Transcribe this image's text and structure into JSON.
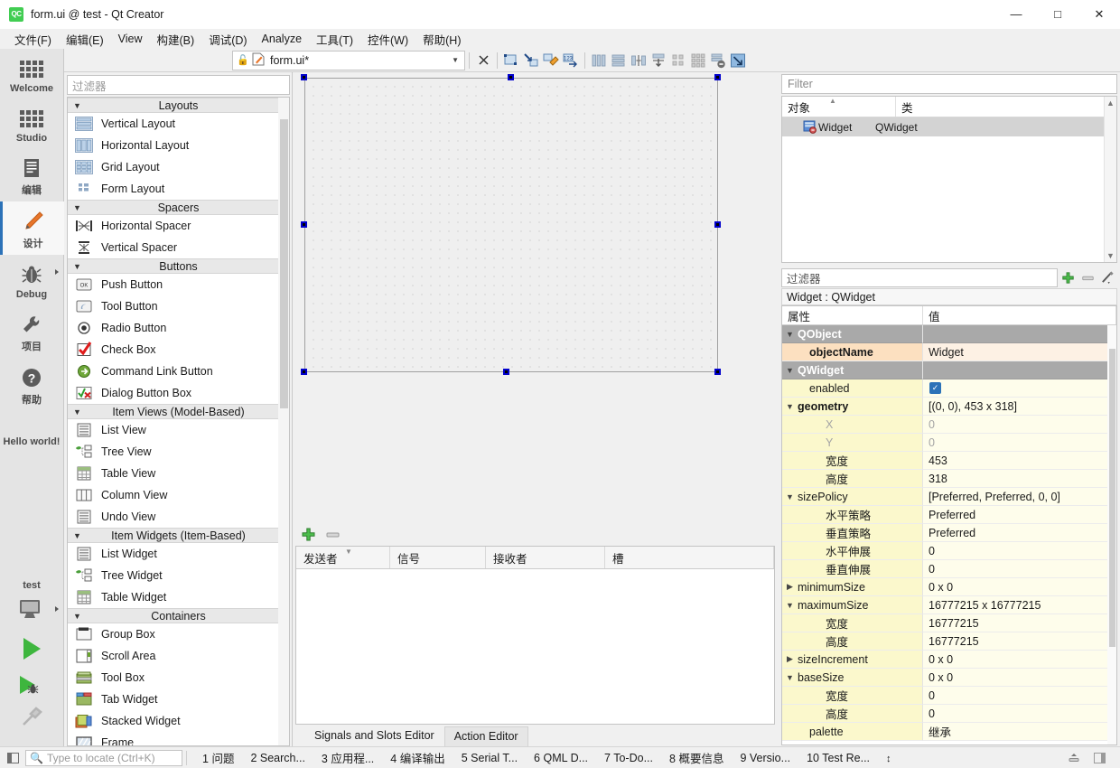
{
  "window": {
    "title": "form.ui @ test - Qt Creator",
    "app_icon_text": "QC",
    "minimize": "—",
    "maximize": "□",
    "close": "✕"
  },
  "menubar": {
    "items": [
      {
        "label": "文件(F)",
        "mnemonic": "F"
      },
      {
        "label": "编辑(E)",
        "mnemonic": "E"
      },
      {
        "label": "View",
        "mnemonic": "V"
      },
      {
        "label": "构建(B)",
        "mnemonic": "B"
      },
      {
        "label": "调试(D)",
        "mnemonic": "D"
      },
      {
        "label": "Analyze",
        "mnemonic": "A"
      },
      {
        "label": "工具(T)",
        "mnemonic": "T"
      },
      {
        "label": "控件(W)",
        "mnemonic": "W"
      },
      {
        "label": "帮助(H)",
        "mnemonic": "H"
      }
    ]
  },
  "modebar": {
    "items": [
      {
        "label": "Welcome",
        "icon": "grid-dots-icon",
        "active": false,
        "arrow": false
      },
      {
        "label": "Studio",
        "icon": "grid-dots-icon",
        "active": false,
        "arrow": false
      },
      {
        "label": "编辑",
        "icon": "document-lines-icon",
        "active": false,
        "arrow": false
      },
      {
        "label": "设计",
        "icon": "pencil-icon",
        "active": true,
        "arrow": false
      },
      {
        "label": "Debug",
        "icon": "bug-icon",
        "active": false,
        "arrow": true
      },
      {
        "label": "项目",
        "icon": "wrench-icon",
        "active": false,
        "arrow": false
      },
      {
        "label": "帮助",
        "icon": "question-circle-icon",
        "active": false,
        "arrow": false
      }
    ],
    "hello_world": "Hello world!",
    "kit_name": "test",
    "kit_icon": "desktop-monitor-icon",
    "run_icon": "run-play-icon",
    "debug_icon": "debug-play-icon",
    "build_icon": "hammer-icon"
  },
  "editor_toolbar": {
    "file_name": "form.ui*",
    "lock_icon": "unlocked-icon",
    "file_icon": "ui-file-icon",
    "dropdown_icon": "chevron-down-icon",
    "close_icon": "close-x-icon",
    "buttons": [
      {
        "name": "edit-widgets-button"
      },
      {
        "name": "edit-signals-slots-button"
      },
      {
        "name": "edit-buddies-button"
      },
      {
        "name": "edit-tab-order-button"
      },
      {
        "name": "layout-horizontally-button"
      },
      {
        "name": "layout-vertically-button"
      },
      {
        "name": "layout-splitter-horizontal-button"
      },
      {
        "name": "layout-splitter-vertical-button"
      },
      {
        "name": "layout-form-button"
      },
      {
        "name": "layout-grid-button"
      },
      {
        "name": "break-layout-button"
      },
      {
        "name": "adjust-size-button"
      }
    ]
  },
  "widget_box": {
    "filter_placeholder": "过滤器",
    "groups": [
      {
        "title": "Layouts",
        "items": [
          {
            "label": "Vertical Layout",
            "icon": "vertical-layout-icon"
          },
          {
            "label": "Horizontal Layout",
            "icon": "horizontal-layout-icon"
          },
          {
            "label": "Grid Layout",
            "icon": "grid-layout-icon"
          },
          {
            "label": "Form Layout",
            "icon": "form-layout-icon"
          }
        ]
      },
      {
        "title": "Spacers",
        "items": [
          {
            "label": "Horizontal Spacer",
            "icon": "horizontal-spacer-icon"
          },
          {
            "label": "Vertical Spacer",
            "icon": "vertical-spacer-icon"
          }
        ]
      },
      {
        "title": "Buttons",
        "items": [
          {
            "label": "Push Button",
            "icon": "push-button-icon"
          },
          {
            "label": "Tool Button",
            "icon": "tool-button-icon"
          },
          {
            "label": "Radio Button",
            "icon": "radio-button-icon"
          },
          {
            "label": "Check Box",
            "icon": "check-box-icon"
          },
          {
            "label": "Command Link Button",
            "icon": "command-link-button-icon"
          },
          {
            "label": "Dialog Button Box",
            "icon": "dialog-button-box-icon"
          }
        ]
      },
      {
        "title": "Item Views (Model-Based)",
        "items": [
          {
            "label": "List View",
            "icon": "list-view-icon"
          },
          {
            "label": "Tree View",
            "icon": "tree-view-icon"
          },
          {
            "label": "Table View",
            "icon": "table-view-icon"
          },
          {
            "label": "Column View",
            "icon": "column-view-icon"
          },
          {
            "label": "Undo View",
            "icon": "undo-view-icon"
          }
        ]
      },
      {
        "title": "Item Widgets (Item-Based)",
        "items": [
          {
            "label": "List Widget",
            "icon": "list-widget-icon"
          },
          {
            "label": "Tree Widget",
            "icon": "tree-widget-icon"
          },
          {
            "label": "Table Widget",
            "icon": "table-widget-icon"
          }
        ]
      },
      {
        "title": "Containers",
        "items": [
          {
            "label": "Group Box",
            "icon": "group-box-icon"
          },
          {
            "label": "Scroll Area",
            "icon": "scroll-area-icon"
          },
          {
            "label": "Tool Box",
            "icon": "tool-box-icon"
          },
          {
            "label": "Tab Widget",
            "icon": "tab-widget-icon"
          },
          {
            "label": "Stacked Widget",
            "icon": "stacked-widget-icon"
          },
          {
            "label": "Frame",
            "icon": "frame-icon"
          }
        ]
      }
    ]
  },
  "form_canvas": {
    "widget_name": "Widget",
    "selected": true,
    "handle_color": "#0000cc"
  },
  "signals_slots": {
    "add_icon": "add-plus-icon",
    "remove_icon": "remove-minus-icon",
    "columns": [
      "发送者",
      "信号",
      "接收者",
      "槽"
    ],
    "rows": [],
    "tabs": [
      {
        "label": "Signals and Slots Editor",
        "active": true
      },
      {
        "label": "Action Editor",
        "active": false
      }
    ]
  },
  "object_inspector": {
    "filter_placeholder": "Filter",
    "columns": [
      "对象",
      "类"
    ],
    "rows": [
      {
        "object": "Widget",
        "class": "QWidget",
        "icon": "qwidget-icon",
        "selected": true
      }
    ]
  },
  "property_editor": {
    "filter_placeholder": "过滤器",
    "add_icon": "add-plus-icon",
    "remove_icon": "remove-minus-icon",
    "config_icon": "configure-wand-icon",
    "object_line": "Widget : QWidget",
    "columns": [
      "属性",
      "值"
    ],
    "rows": [
      {
        "kind": "group",
        "indent": 0,
        "caret": "down",
        "name": "QObject",
        "value": ""
      },
      {
        "kind": "orange",
        "indent": 1,
        "caret": "",
        "name": "objectName",
        "value": "Widget"
      },
      {
        "kind": "group",
        "indent": 0,
        "caret": "down",
        "name": "QWidget",
        "value": ""
      },
      {
        "kind": "yellow",
        "indent": 1,
        "caret": "",
        "name": "enabled",
        "value": "",
        "checkbox": true
      },
      {
        "kind": "yellow",
        "indent": 0,
        "caret": "down",
        "name": "geometry",
        "value": "[(0, 0), 453 x 318]",
        "bold": true
      },
      {
        "kind": "sub",
        "indent": 2,
        "caret": "",
        "name": "X",
        "value": "0",
        "dim": true
      },
      {
        "kind": "sub",
        "indent": 2,
        "caret": "",
        "name": "Y",
        "value": "0",
        "dim": true
      },
      {
        "kind": "sub",
        "indent": 2,
        "caret": "",
        "name": "宽度",
        "value": "453"
      },
      {
        "kind": "sub",
        "indent": 2,
        "caret": "",
        "name": "高度",
        "value": "318"
      },
      {
        "kind": "yellow",
        "indent": 0,
        "caret": "down",
        "name": "sizePolicy",
        "value": "[Preferred, Preferred, 0, 0]"
      },
      {
        "kind": "sub",
        "indent": 2,
        "caret": "",
        "name": "水平策略",
        "value": "Preferred"
      },
      {
        "kind": "sub",
        "indent": 2,
        "caret": "",
        "name": "垂直策略",
        "value": "Preferred"
      },
      {
        "kind": "sub",
        "indent": 2,
        "caret": "",
        "name": "水平伸展",
        "value": "0"
      },
      {
        "kind": "sub",
        "indent": 2,
        "caret": "",
        "name": "垂直伸展",
        "value": "0"
      },
      {
        "kind": "yellow",
        "indent": 0,
        "caret": "right",
        "name": "minimumSize",
        "value": "0 x 0"
      },
      {
        "kind": "yellow",
        "indent": 0,
        "caret": "down",
        "name": "maximumSize",
        "value": "16777215 x 16777215"
      },
      {
        "kind": "sub",
        "indent": 2,
        "caret": "",
        "name": "宽度",
        "value": "16777215"
      },
      {
        "kind": "sub",
        "indent": 2,
        "caret": "",
        "name": "高度",
        "value": "16777215"
      },
      {
        "kind": "yellow",
        "indent": 0,
        "caret": "right",
        "name": "sizeIncrement",
        "value": "0 x 0"
      },
      {
        "kind": "yellow",
        "indent": 0,
        "caret": "down",
        "name": "baseSize",
        "value": "0 x 0"
      },
      {
        "kind": "sub",
        "indent": 2,
        "caret": "",
        "name": "宽度",
        "value": "0"
      },
      {
        "kind": "sub",
        "indent": 2,
        "caret": "",
        "name": "高度",
        "value": "0"
      },
      {
        "kind": "yellow",
        "indent": 1,
        "caret": "",
        "name": "palette",
        "value": "继承"
      }
    ]
  },
  "statusbar": {
    "sidebar_toggle_icon": "sidebar-toggle-icon",
    "locator_placeholder": "Type to locate (Ctrl+K)",
    "locator_icon": "search-icon",
    "items": [
      {
        "num": "1",
        "label": "问题"
      },
      {
        "num": "2",
        "label": "Search..."
      },
      {
        "num": "3",
        "label": "应用程..."
      },
      {
        "num": "4",
        "label": "编译输出"
      },
      {
        "num": "5",
        "label": "Serial T..."
      },
      {
        "num": "6",
        "label": "QML D..."
      },
      {
        "num": "7",
        "label": "To-Do..."
      },
      {
        "num": "8",
        "label": "概要信息"
      },
      {
        "num": "9",
        "label": "Versio..."
      },
      {
        "num": "10",
        "label": "Test Re..."
      }
    ],
    "updown_icon": "up-down-arrows-icon",
    "right_buttons": [
      {
        "name": "minimize-output-pane-button"
      },
      {
        "name": "toggle-right-sidebar-button"
      }
    ]
  },
  "colors": {
    "accent": "#2c72b8",
    "qt_green": "#41cd52",
    "selection_handle": "#0000cc",
    "group_row": "#a9a9a9",
    "yellow_row": "#fbf8cc",
    "orange_row": "#fce0c0"
  }
}
